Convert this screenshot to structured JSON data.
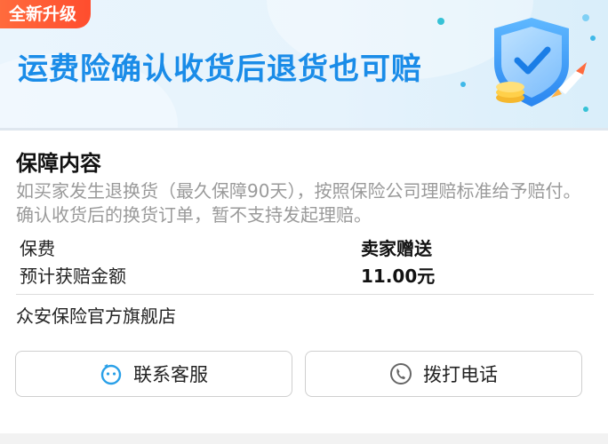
{
  "banner": {
    "badge": "全新升级",
    "title": "运费险确认收货后退货也可赔"
  },
  "coverage": {
    "title": "保障内容",
    "description": "如买家发生退换货（最久保障90天），按照保险公司理赔标准给予赔付。确认收货后的换货订单，暂不支持发起理赔。",
    "rows": [
      {
        "label": "保费",
        "value": "卖家赠送"
      },
      {
        "label": "预计获赔金额",
        "value": "11.00元"
      }
    ],
    "shop": "众安保险官方旗舰店"
  },
  "actions": {
    "contact_label": "联系客服",
    "call_label": "拨打电话"
  },
  "icons": {
    "banner_icon": "shield-check-icon",
    "contact_icon": "chat-face-icon",
    "call_icon": "phone-icon"
  },
  "colors": {
    "accent_blue": "#1a8ce8",
    "badge_orange": "#ff5a32",
    "muted_text": "#9a9a9a"
  }
}
